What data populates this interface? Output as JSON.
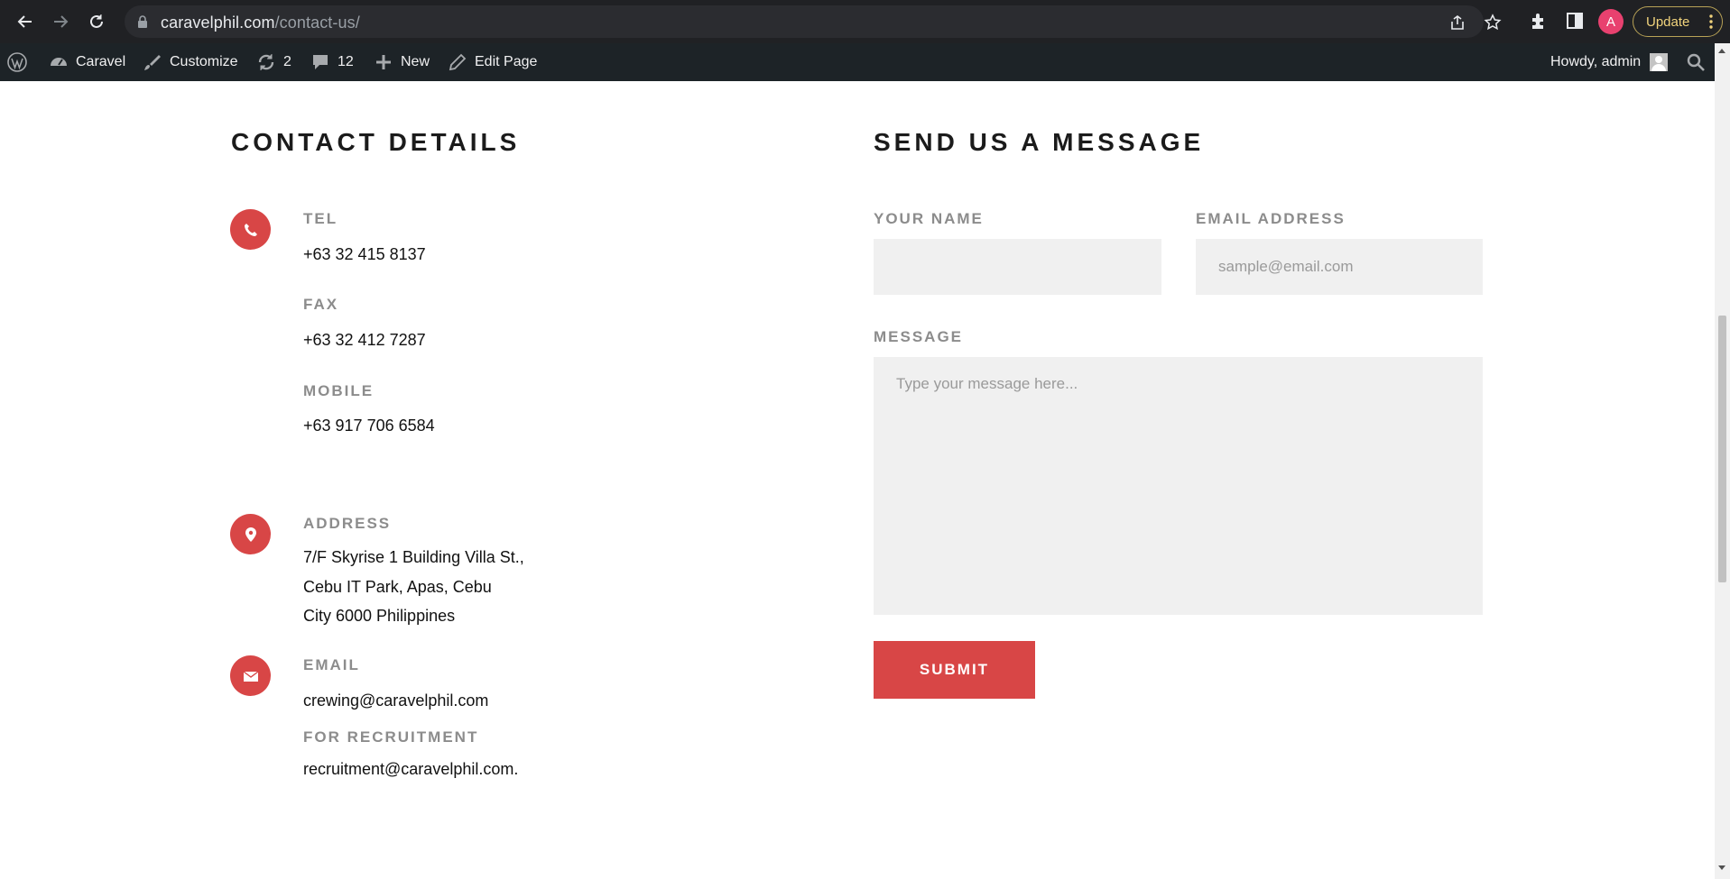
{
  "browser": {
    "url_domain": "caravelphil.com",
    "url_path": "/contact-us/",
    "profile_initial": "A",
    "update_label": "Update"
  },
  "admin_bar": {
    "site_name": "Caravel",
    "customize": "Customize",
    "updates_count": "2",
    "comments_count": "12",
    "new_label": "New",
    "edit_page": "Edit Page",
    "howdy": "Howdy, admin"
  },
  "contact": {
    "title": "CONTACT DETAILS",
    "tel_label": "TEL",
    "tel_value": "+63 32 415 8137",
    "fax_label": "FAX",
    "fax_value": "+63 32 412 7287",
    "mobile_label": "MOBILE",
    "mobile_value": "+63 917 706 6584",
    "address_label": "ADDRESS",
    "address_lines": [
      "7/F Skyrise 1 Building Villa St.,",
      "Cebu IT Park, Apas, Cebu",
      "City 6000 Philippines"
    ],
    "email_label": "EMAIL",
    "email_value": "crewing@caravelphil.com",
    "recruitment_label": "FOR RECRUITMENT",
    "recruitment_value": "recruitment@caravelphil.com."
  },
  "form": {
    "title": "SEND US A MESSAGE",
    "name_label": "YOUR NAME",
    "name_value": "",
    "email_label": "EMAIL ADDRESS",
    "email_placeholder": "sample@email.com",
    "message_label": "MESSAGE",
    "message_placeholder": "Type your message here...",
    "submit_label": "SUBMIT"
  },
  "colors": {
    "accent": "#d84646",
    "label_gray": "#8c8c8c",
    "field_bg": "#f0f0f0",
    "chrome_bg": "#202124",
    "admin_bar_bg": "#1d2327"
  }
}
